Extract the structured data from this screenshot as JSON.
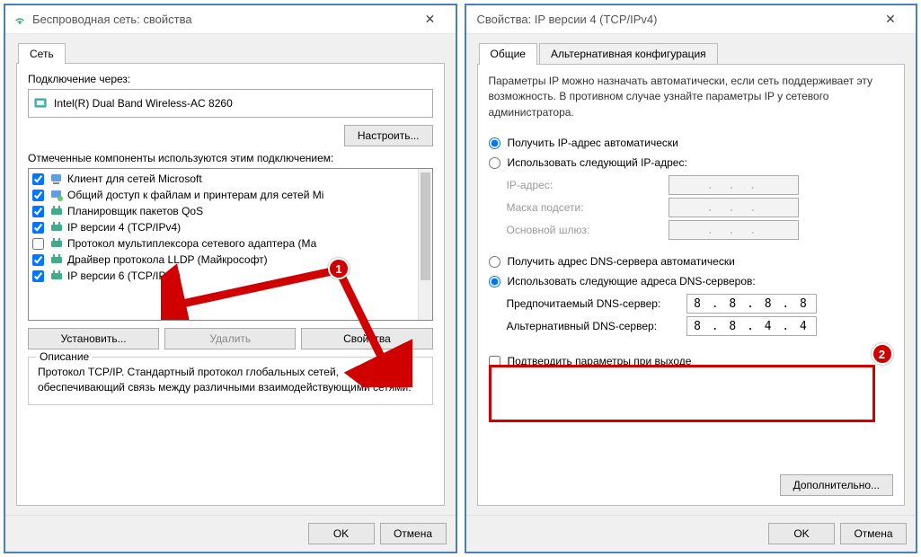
{
  "left": {
    "title": "Беспроводная сеть: свойства",
    "tab_network": "Сеть",
    "connect_via_label": "Подключение через:",
    "adapter_name": "Intel(R) Dual Band Wireless-AC 8260",
    "configure_btn": "Настроить...",
    "components_label": "Отмеченные компоненты используются этим подключением:",
    "components": [
      {
        "checked": true,
        "label": "Клиент для сетей Microsoft",
        "icon": "client"
      },
      {
        "checked": true,
        "label": "Общий доступ к файлам и принтерам для сетей Mi",
        "icon": "share"
      },
      {
        "checked": true,
        "label": "Планировщик пакетов QoS",
        "icon": "qos"
      },
      {
        "checked": true,
        "label": "IP версии 4 (TCP/IPv4)",
        "icon": "proto"
      },
      {
        "checked": false,
        "label": "Протокол мультиплексора сетевого адаптера (Ма",
        "icon": "proto"
      },
      {
        "checked": true,
        "label": "Драйвер протокола LLDP (Майкрософт)",
        "icon": "proto"
      },
      {
        "checked": true,
        "label": "IP версии 6 (TCP/IPv6)",
        "icon": "proto"
      }
    ],
    "install_btn": "Установить...",
    "remove_btn": "Удалить",
    "properties_btn": "Свойства",
    "desc_title": "Описание",
    "desc_text": "Протокол TCP/IP. Стандартный протокол глобальных сетей, обеспечивающий связь между различными взаимодействующими сетями.",
    "ok_btn": "OK",
    "cancel_btn": "Отмена"
  },
  "right": {
    "title": "Свойства: IP версии 4 (TCP/IPv4)",
    "tab_general": "Общие",
    "tab_alt": "Альтернативная конфигурация",
    "info_text": "Параметры IP можно назначать автоматически, если сеть поддерживает эту возможность. В противном случае узнайте параметры IP у сетевого администратора.",
    "ip_auto": "Получить IP-адрес автоматически",
    "ip_manual": "Использовать следующий IP-адрес:",
    "ip_address_label": "IP-адрес:",
    "subnet_label": "Маска подсети:",
    "gateway_label": "Основной шлюз:",
    "dots": ".     .     .",
    "dns_auto": "Получить адрес DNS-сервера автоматически",
    "dns_manual": "Использовать следующие адреса DNS-серверов:",
    "dns_pref_label": "Предпочитаемый DNS-сервер:",
    "dns_alt_label": "Альтернативный DNS-сервер:",
    "dns_pref_value": "8 . 8 . 8 . 8",
    "dns_alt_value": "8 . 8 . 4 . 4",
    "validate_label": "Подтвердить параметры при выходе",
    "advanced_btn": "Дополнительно...",
    "ok_btn": "OK",
    "cancel_btn": "Отмена"
  },
  "annotations": {
    "badge1": "1",
    "badge2": "2"
  }
}
